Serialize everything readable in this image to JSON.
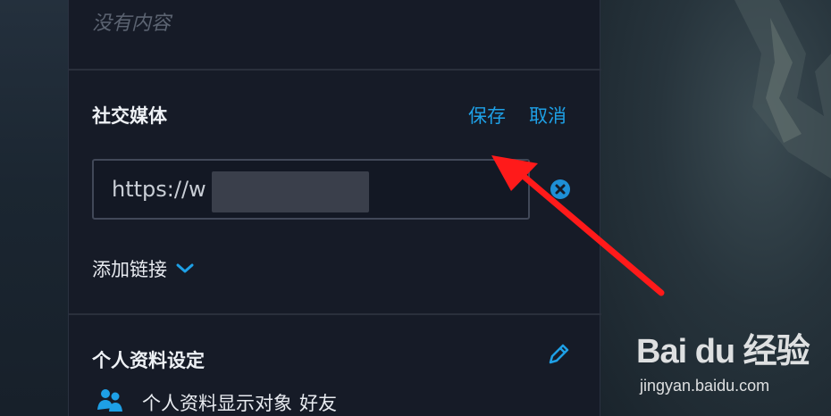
{
  "previous_section": {
    "empty_text": "没有内容"
  },
  "social_media": {
    "title": "社交媒体",
    "save_label": "保存",
    "cancel_label": "取消",
    "url_value": "https://w               m",
    "clear_icon": "clear-circle-icon",
    "add_link_label": "添加链接",
    "add_link_icon": "chevron-down-icon"
  },
  "profile_settings": {
    "title": "个人资料设定",
    "edit_icon": "pencil-icon",
    "visibility_icon": "users-icon",
    "visibility_label": "个人资料显示对象",
    "visibility_value": "好友"
  },
  "watermark": {
    "logo_text": "Bai du 经验",
    "url": "jingyan.baidu.com"
  },
  "colors": {
    "panel_bg": "#161b27",
    "accent": "#1ea0e6",
    "annotation_arrow": "#ff1a1a"
  }
}
